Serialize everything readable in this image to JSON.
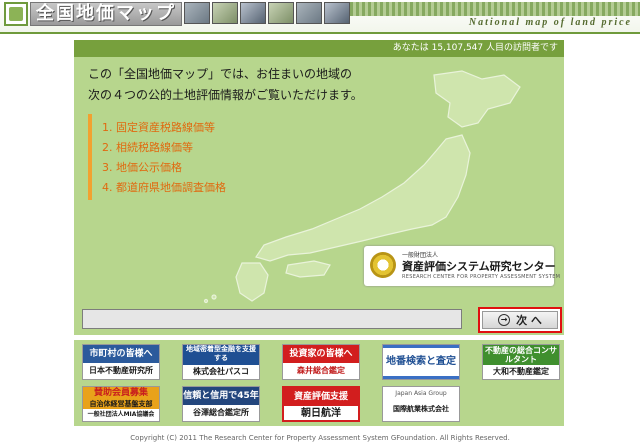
{
  "header": {
    "site_title": "全国地価マップ",
    "subtitle": "National map of land price"
  },
  "main": {
    "visitor_text": "あなたは 15,107,547 人目の訪問者です",
    "intro_line1": "この「全国地価マップ」では、お住まいの地域の",
    "intro_line2": "次の４つの公的土地評価情報がご覧いただけます。",
    "list": [
      "1. 固定資産税路線価等",
      "2. 相続税路線価等",
      "3. 地価公示価格",
      "4. 都道府県地価調査価格"
    ],
    "org": {
      "small": "一般財団法人",
      "name": "資産評価システム研究センター",
      "english": "RESEARCH CENTER FOR PROPERTY ASSESSMENT SYSTEM"
    }
  },
  "search": {
    "value": "",
    "next_label": "次 へ"
  },
  "banners": [
    {
      "top": "市町村の皆様へ",
      "bottom": "日本不動産研究所"
    },
    {
      "top": "地域密着型金融を支援する",
      "bottom": "株式会社パスコ"
    },
    {
      "top": "投資家の皆様へ",
      "bottom": "森井総合鑑定"
    },
    {
      "top": "地番検索と査定",
      "bottom": ""
    },
    {
      "top": "不動産の総合コンサルタント",
      "bottom": "大和不動産鑑定"
    },
    {
      "top": "賛助会員募集",
      "middle": "自治体経営基盤支部",
      "bottom": "一般社団法人MIA協議会"
    },
    {
      "top": "信頼と信用で45年",
      "bottom": "谷澤総合鑑定所"
    },
    {
      "top": "資産評価支援",
      "bottom": "朝日航洋"
    },
    {
      "top": "Japan Asia Group",
      "bottom": "国際航業株式会社"
    }
  ],
  "colors": {
    "panel_green": "#b7d68d",
    "bar_green": "#77a03d",
    "list_orange": "#e06a10",
    "button_border": "#e01010"
  },
  "footer": "Copyright (C) 2011 The Research Center for Property Assessment System GFoundation. All Rights Reserved."
}
